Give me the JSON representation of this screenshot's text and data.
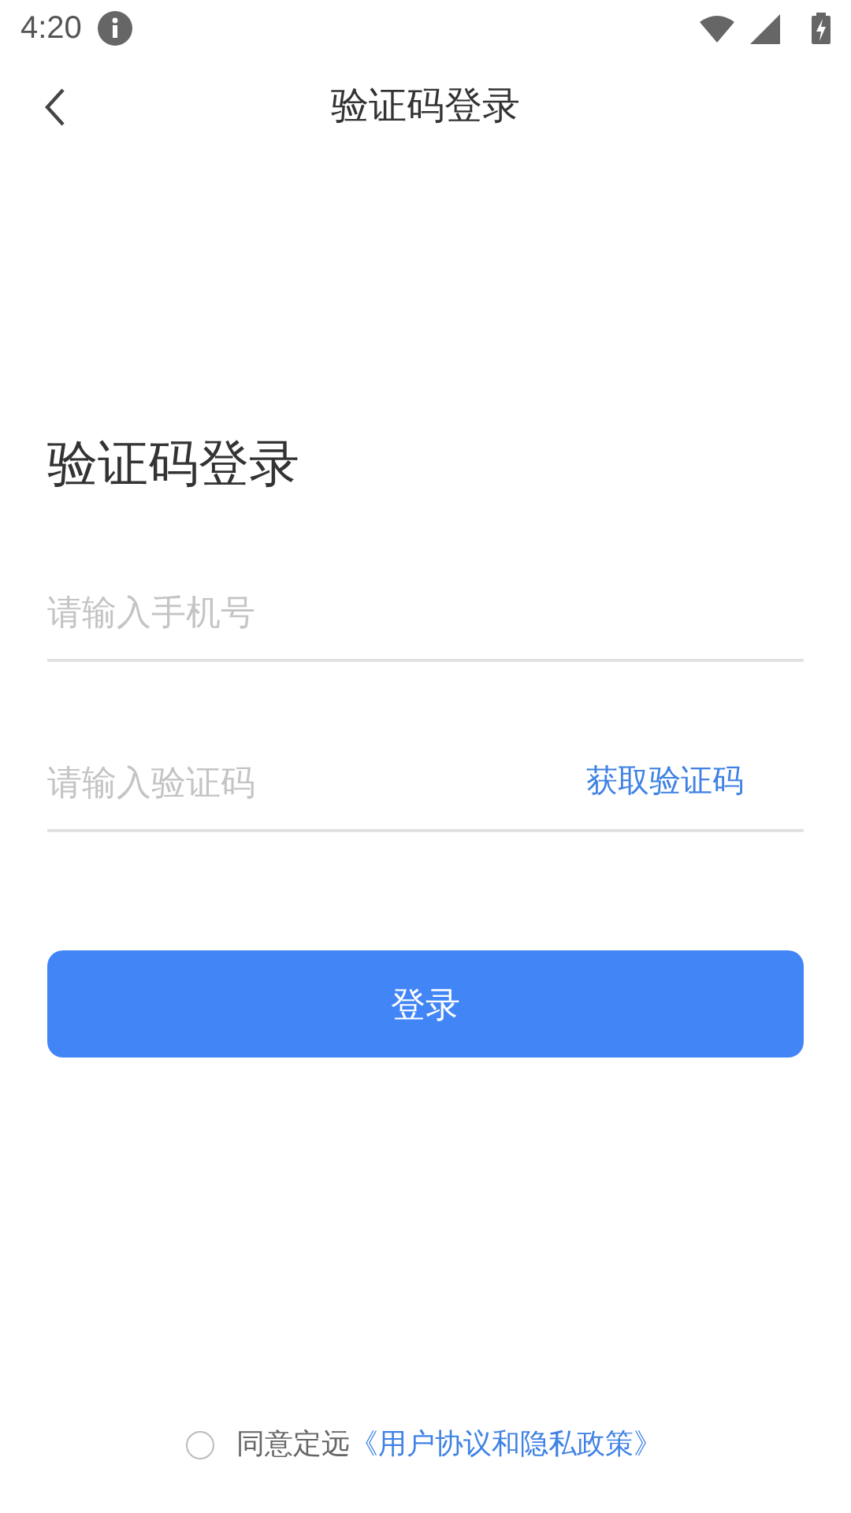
{
  "status_bar": {
    "time": "4:20"
  },
  "header": {
    "title": "验证码登录"
  },
  "heading": "验证码登录",
  "phone_field": {
    "placeholder": "请输入手机号"
  },
  "code_field": {
    "placeholder": "请输入验证码",
    "action": "获取验证码"
  },
  "login_button": "登录",
  "agreement": {
    "checked": false,
    "text": "同意定远",
    "link": "《用户协议和隐私政策》"
  }
}
